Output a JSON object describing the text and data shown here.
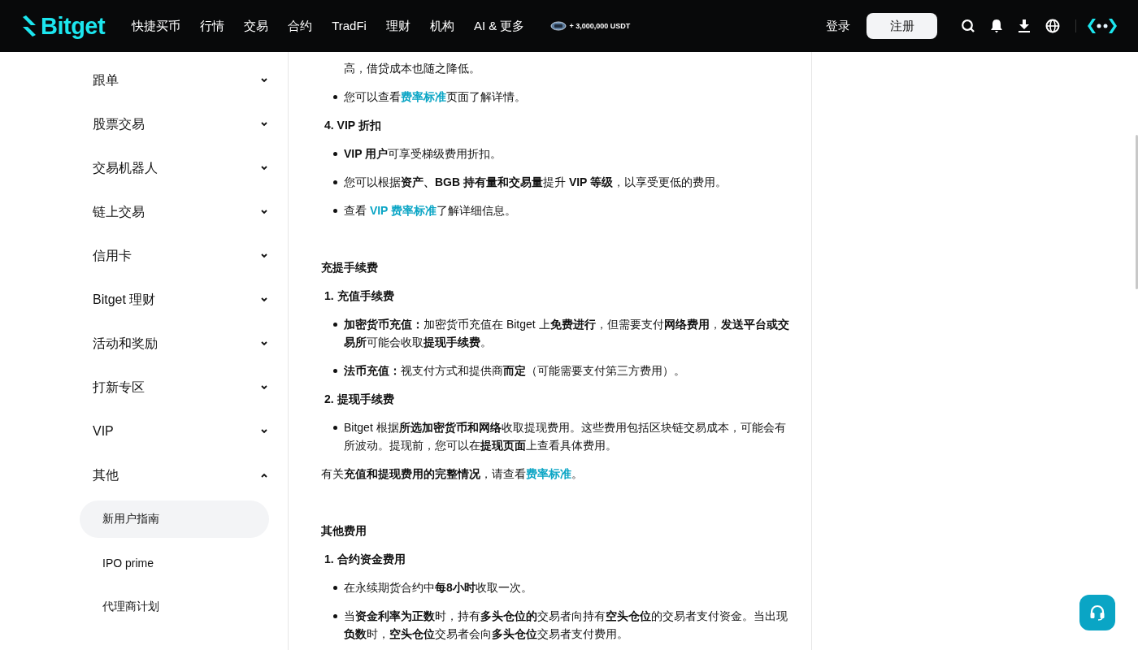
{
  "header": {
    "logo": "Bitget",
    "nav": [
      "快捷买币",
      "行情",
      "交易",
      "合约",
      "TradFi",
      "理财",
      "机构",
      "AI & 更多"
    ],
    "promo": "+ 3,000,000 USDT",
    "login": "登录",
    "signup": "注册"
  },
  "sidebar": {
    "items": [
      {
        "label": "跟单",
        "expanded": false
      },
      {
        "label": "股票交易",
        "expanded": false
      },
      {
        "label": "交易机器人",
        "expanded": false
      },
      {
        "label": "链上交易",
        "expanded": false
      },
      {
        "label": "信用卡",
        "expanded": false
      },
      {
        "label": "Bitget 理财",
        "expanded": false
      },
      {
        "label": "活动和奖励",
        "expanded": false
      },
      {
        "label": "打新专区",
        "expanded": false
      },
      {
        "label": "VIP",
        "expanded": false
      },
      {
        "label": "其他",
        "expanded": true,
        "children": [
          {
            "label": "新用户指南",
            "selected": true
          },
          {
            "label": "IPO prime",
            "selected": false
          },
          {
            "label": "代理商计划",
            "selected": false
          }
        ]
      }
    ]
  },
  "article": [
    {
      "kind": "continuation",
      "parts": [
        {
          "kind": "text",
          "text": "高，借贷成本也随之降低。"
        }
      ]
    },
    {
      "kind": "bullet",
      "parts": [
        {
          "kind": "text",
          "text": "您可以查看"
        },
        {
          "kind": "link",
          "text": "费率标准"
        },
        {
          "kind": "text",
          "text": "页面了解详情。"
        }
      ]
    },
    {
      "kind": "heading",
      "parts": [
        {
          "kind": "text",
          "text": "4. VIP 折扣"
        }
      ]
    },
    {
      "kind": "bullet",
      "parts": [
        {
          "kind": "text",
          "text": "**VIP 用户**可享受梯级费用折扣。"
        }
      ]
    },
    {
      "kind": "bullet",
      "parts": [
        {
          "kind": "text",
          "text": "您可以根据**资产、BGB 持有量和交易量**提升 **VIP 等级**，以享受更低的费用。"
        }
      ]
    },
    {
      "kind": "bullet",
      "parts": [
        {
          "kind": "text",
          "text": "查看 "
        },
        {
          "kind": "link",
          "text": "VIP 费率标准"
        },
        {
          "kind": "text",
          "text": "了解详细信息。"
        }
      ]
    },
    {
      "kind": "section",
      "parts": [
        {
          "kind": "text",
          "text": "充提手续费"
        }
      ]
    },
    {
      "kind": "heading",
      "parts": [
        {
          "kind": "text",
          "text": "1. 充值手续费"
        }
      ]
    },
    {
      "kind": "bullet",
      "parts": [
        {
          "kind": "text",
          "text": "**加密货币充值：**加密货币充值在 Bitget 上**免费进行**，但需要支付**网络费用**，**发送平台或交易所**可能会收取**提现手续费**。"
        }
      ]
    },
    {
      "kind": "bullet",
      "parts": [
        {
          "kind": "text",
          "text": "**法币充值：**视支付方式和提供商**而定**（可能需要支付第三方费用）。"
        }
      ]
    },
    {
      "kind": "heading",
      "parts": [
        {
          "kind": "text",
          "text": "2. 提现手续费"
        }
      ]
    },
    {
      "kind": "bullet",
      "parts": [
        {
          "kind": "text",
          "text": "Bitget 根据**所选加密货币和网络**收取提现费用。这些费用包括区块链交易成本，可能会有所波动。提现前，您可以在**提现页面**上查看具体费用。"
        }
      ]
    },
    {
      "kind": "paragraph",
      "parts": [
        {
          "kind": "text",
          "text": "有关**充值和提现费用的完整情况**，请查看"
        },
        {
          "kind": "link",
          "text": "费率标准"
        },
        {
          "kind": "text",
          "text": "。"
        }
      ]
    },
    {
      "kind": "section",
      "parts": [
        {
          "kind": "text",
          "text": "其他费用"
        }
      ]
    },
    {
      "kind": "heading",
      "parts": [
        {
          "kind": "text",
          "text": "1. 合约资金费用"
        }
      ]
    },
    {
      "kind": "bullet",
      "parts": [
        {
          "kind": "text",
          "text": "在永续期货合约中**每8小时**收取一次。"
        }
      ]
    },
    {
      "kind": "bullet",
      "parts": [
        {
          "kind": "text",
          "text": "当**资金利率为正数**时，持有**多头仓位的**交易者向持有**空头仓位**的交易者支付资金。当出现**负数**时，**空头仓位**交易者会向**多头仓位**交易者支付费用。"
        }
      ]
    }
  ]
}
